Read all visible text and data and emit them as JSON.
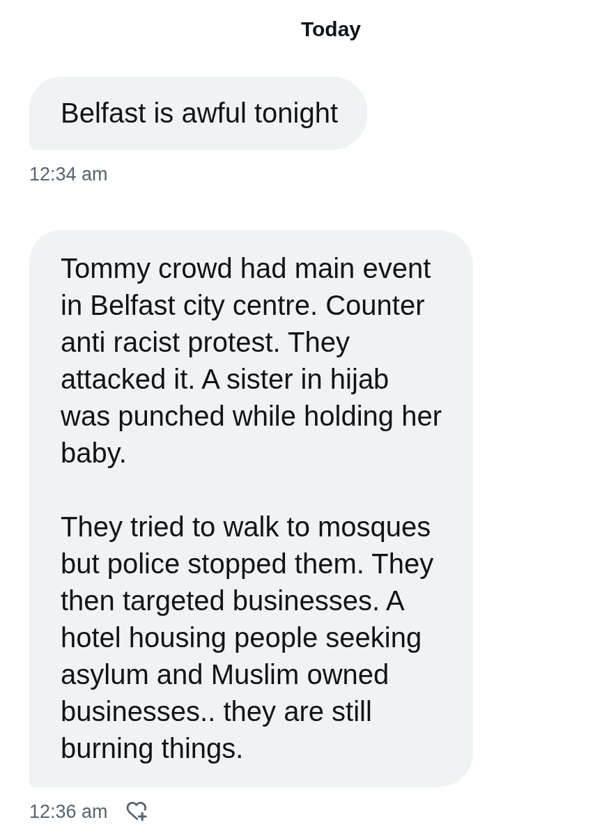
{
  "header": {
    "date_label": "Today"
  },
  "messages": [
    {
      "paragraphs": [
        "Belfast is awful tonight"
      ],
      "time": "12:34 am",
      "reaction_button": false
    },
    {
      "paragraphs": [
        "Tommy crowd had main event in Belfast city centre. Counter anti racist protest. They attacked it. A sister in hijab was punched while holding her baby.",
        "They tried to walk to mosques but police stopped them. They then targeted businesses. A hotel housing people seeking asylum and Muslim owned businesses.. they are still burning things."
      ],
      "time": "12:36 am",
      "reaction_button": true
    }
  ]
}
